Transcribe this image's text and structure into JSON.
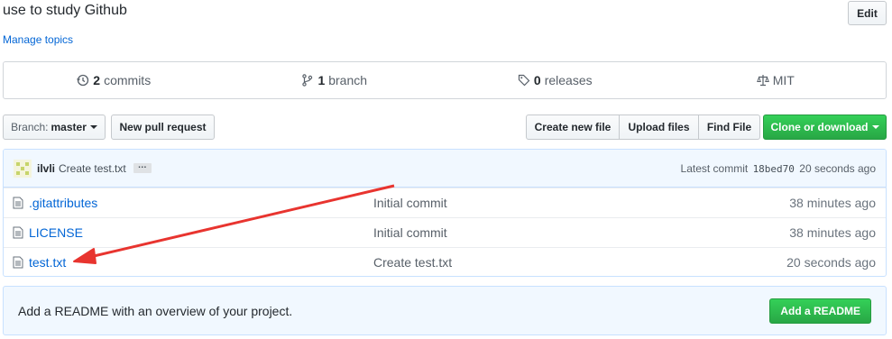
{
  "repo": {
    "description": "use to study Github",
    "manage_topics": "Manage topics",
    "edit_label": "Edit"
  },
  "summary": {
    "commits_count": "2",
    "commits_label": "commits",
    "branches_count": "1",
    "branches_label": "branch",
    "releases_count": "0",
    "releases_label": "releases",
    "license": "MIT"
  },
  "toolbar": {
    "branch_prefix": "Branch:",
    "branch_name": "master",
    "new_pull_request": "New pull request",
    "create_new_file": "Create new file",
    "upload_files": "Upload files",
    "find_file": "Find File",
    "clone_or_download": "Clone or download"
  },
  "latest_commit": {
    "author": "ilvli",
    "message": "Create test.txt",
    "ellipsis": "…",
    "label": "Latest commit",
    "sha": "18bed70",
    "age": "20 seconds ago"
  },
  "files": [
    {
      "name": ".gitattributes",
      "message": "Initial commit",
      "age": "38 minutes ago"
    },
    {
      "name": "LICENSE",
      "message": "Initial commit",
      "age": "38 minutes ago"
    },
    {
      "name": "test.txt",
      "message": "Create test.txt",
      "age": "20 seconds ago"
    }
  ],
  "readme": {
    "text": "Add a README with an overview of your project.",
    "button": "Add a README"
  },
  "colors": {
    "link": "#0366d6",
    "primary_green": "#28a745",
    "annotation_arrow": "#e8342f"
  }
}
